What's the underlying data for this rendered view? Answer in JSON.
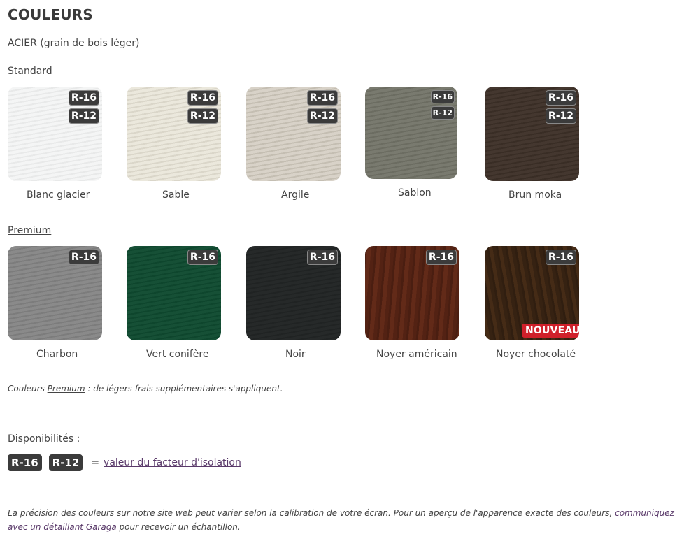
{
  "title": "COULEURS",
  "subtitle": "ACIER (grain de bois léger)",
  "standard": {
    "heading": "Standard",
    "items": [
      {
        "name": "Blanc glacier",
        "color": "#f1f2f2",
        "badges": [
          "R-16",
          "R-12"
        ]
      },
      {
        "name": "Sable",
        "color": "#e6e2d4",
        "badges": [
          "R-16",
          "R-12"
        ]
      },
      {
        "name": "Argile",
        "color": "#cfc8bc",
        "badges": [
          "R-16",
          "R-12"
        ]
      },
      {
        "name": "Sablon",
        "color": "#727367",
        "badges": [
          "R-16",
          "R-12"
        ]
      },
      {
        "name": "Brun moka",
        "color": "#3e3128",
        "badges": [
          "R-16",
          "R-12"
        ]
      }
    ]
  },
  "premium": {
    "heading": "Premium",
    "items": [
      {
        "name": "Charbon",
        "color": "#838383",
        "badges": [
          "R-16"
        ]
      },
      {
        "name": "Vert conifère",
        "color": "#0f4a30",
        "badges": [
          "R-16"
        ]
      },
      {
        "name": "Noir",
        "color": "#222525",
        "badges": [
          "R-16"
        ]
      },
      {
        "name": "Noyer américain",
        "color": "#5a2515",
        "badges": [
          "R-16"
        ]
      },
      {
        "name": "Noyer chocolaté",
        "color": "#3c2614",
        "badges": [
          "R-16"
        ],
        "tag": "NOUVEAU"
      }
    ]
  },
  "premium_note": {
    "prefix": "Couleurs ",
    "link": "Premium",
    "suffix": " : de légers frais supplémentaires s'appliquent."
  },
  "availability": {
    "label": "Disponibilités :",
    "badge1": "R-16",
    "badge2": "R-12",
    "equals": "=",
    "link": "valeur du facteur d'isolation"
  },
  "disclaimer": {
    "text": "La précision des couleurs sur notre site web peut varier selon la calibration de votre écran. Pour un aperçu de l'apparence exacte des couleurs, ",
    "link": "communiquez avec un détaillant Garaga",
    "suffix": " pour recevoir un échantillon."
  },
  "colors": {
    "badge_bg": "#3b3b3b",
    "nouveau_bg": "#d0202a",
    "link": "#5a3a6a"
  }
}
